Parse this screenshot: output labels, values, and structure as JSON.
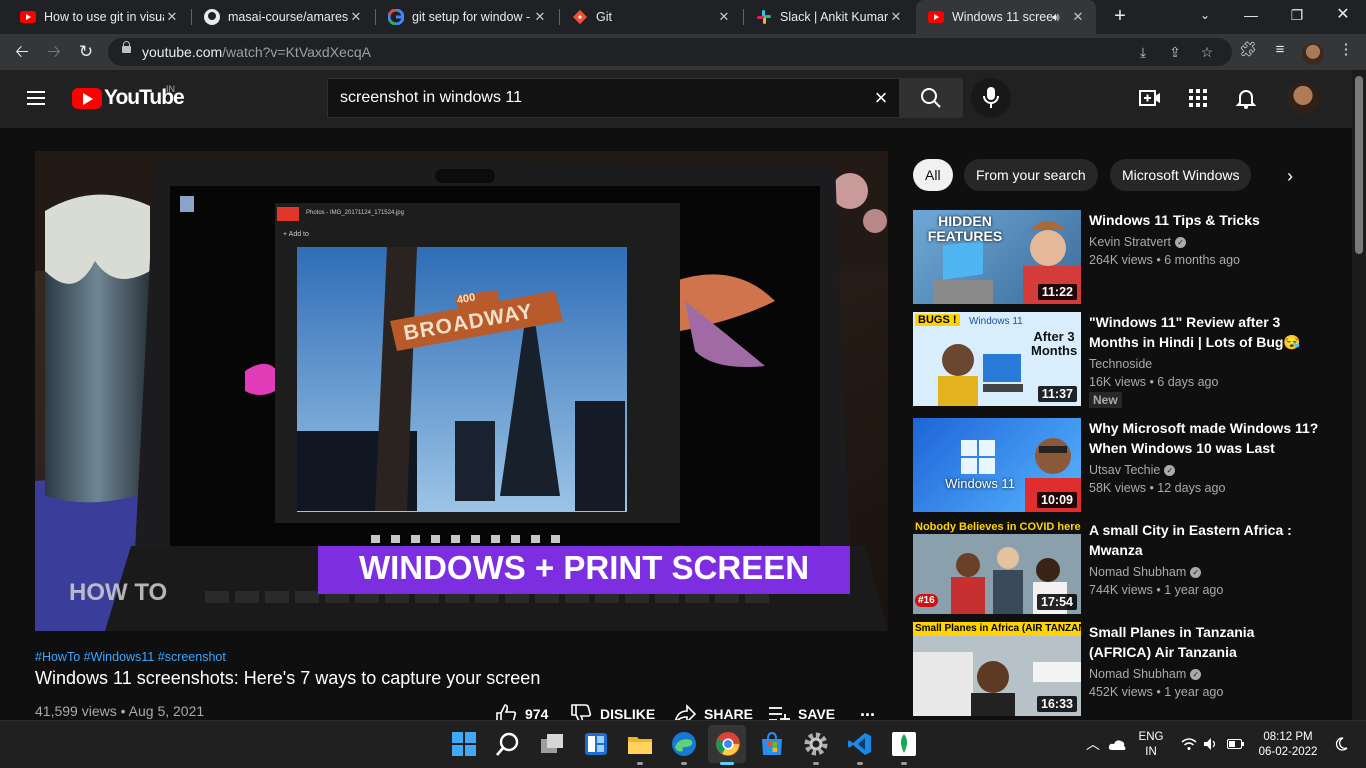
{
  "browser": {
    "tabs": [
      {
        "title": "How to use git in visual",
        "icon": "youtube-icon"
      },
      {
        "title": "masai-course/amaresh",
        "icon": "github-icon"
      },
      {
        "title": "git setup for window -",
        "icon": "google-icon"
      },
      {
        "title": "Git",
        "icon": "git-icon"
      },
      {
        "title": "Slack | Ankit Kumar | M",
        "icon": "slack-icon"
      },
      {
        "title": "Windows 11 scree",
        "icon": "youtube-icon"
      }
    ],
    "url_host": "youtube.com",
    "url_path": "/watch?v=KtVaxdXecqA"
  },
  "youtube": {
    "logo_text": "YouTube",
    "country": "IN",
    "search_value": "screenshot in windows 11"
  },
  "video": {
    "overlay_caption": "WINDOWS + PRINT SCREEN",
    "overlay_howto": "HOW TO",
    "sign_number": "400",
    "sign_text": "BROADWAY",
    "photos_title": "Photos - IMG_20171124_171524.jpg",
    "photos_add": "+ Add to",
    "tags": "#HowTo #Windows11 #screenshot",
    "title": "Windows 11 screenshots: Here's 7 ways to capture your screen",
    "views": "41,599 views",
    "date": "Aug 5, 2021",
    "likes": "974",
    "dislike_label": "DISLIKE",
    "share_label": "SHARE",
    "save_label": "SAVE",
    "more": "..."
  },
  "chips": [
    "All",
    "From your search",
    "Microsoft Windows"
  ],
  "related": [
    {
      "title": "Windows 11 Tips & Tricks",
      "channel": "Kevin Stratvert",
      "verified": true,
      "meta": "264K views • 6 months ago",
      "duration": "11:22",
      "thumb_text": "HIDDEN FEATURES"
    },
    {
      "title": "\"Windows 11\" Review after 3 Months in Hindi | Lots of Bug😪",
      "channel": "Technoside",
      "verified": false,
      "meta": "16K views • 6 days ago",
      "duration": "11:37",
      "badge": "New",
      "thumb_text": "After 3 Months",
      "thumb_bugs": "BUGS !",
      "thumb_brand": "Windows 11"
    },
    {
      "title": "Why Microsoft made Windows 11? When Windows 10 was Last",
      "channel": "Utsav Techie",
      "verified": true,
      "meta": "58K views • 12 days ago",
      "duration": "10:09",
      "thumb_text": "Windows 11"
    },
    {
      "title": "A small City in Eastern Africa : Mwanza",
      "channel": "Nomad Shubham",
      "verified": true,
      "meta": "744K views • 1 year ago",
      "duration": "17:54",
      "thumb_text": "Nobody Believes in COVID here",
      "thumb_tag": "#16"
    },
    {
      "title": "Small Planes in Tanzania (AFRICA) Air Tanzania",
      "channel": "Nomad Shubham",
      "verified": true,
      "meta": "452K views • 1 year ago",
      "duration": "16:33",
      "thumb_text": "Small Planes in Africa (AIR TANZANIA)"
    }
  ],
  "taskbar": {
    "lang": "ENG",
    "region": "IN",
    "time": "08:12 PM",
    "date": "06-02-2022"
  }
}
